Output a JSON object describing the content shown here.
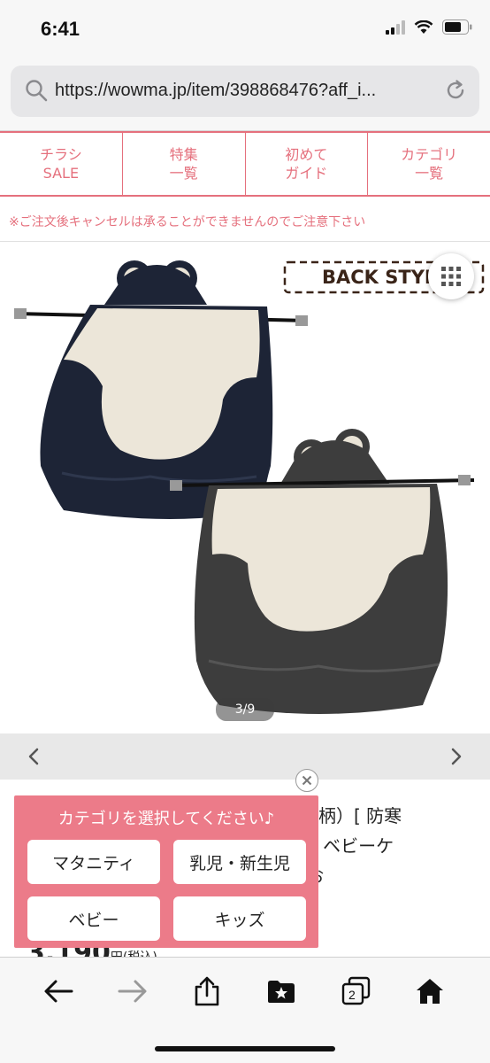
{
  "status_bar": {
    "time": "6:41"
  },
  "browser": {
    "url": "https://wowma.jp/item/398868476?aff_i..."
  },
  "category_nav": {
    "items": [
      {
        "line1": "チラシ",
        "line2": "SALE"
      },
      {
        "line1": "特集",
        "line2": "一覧"
      },
      {
        "line1": "初めて",
        "line2": "ガイド"
      },
      {
        "line1": "カテゴリ",
        "line2": "一覧"
      }
    ]
  },
  "notice": "※ご注文後キャンセルは承ることができませんのでご注意下さい",
  "product": {
    "image_badge": "BACK STYLE",
    "image_counter": "3/9",
    "title_line1": "゜（雲柄）[ 防寒",
    "title_line2": "ケープ ベビーケ",
    "title_line3": "ゃん お",
    "price": "3,190",
    "price_unit": "円(税込)"
  },
  "popup": {
    "title": "カテゴリを選択してください♪",
    "options": [
      "マタニティ",
      "乳児・新生児",
      "ベビー",
      "キッズ"
    ]
  },
  "toolbar": {
    "tabs_count": "2"
  },
  "colors": {
    "accent": "#e5707d",
    "popup_bg": "#ec7b89",
    "ios_blue": "#111111"
  }
}
